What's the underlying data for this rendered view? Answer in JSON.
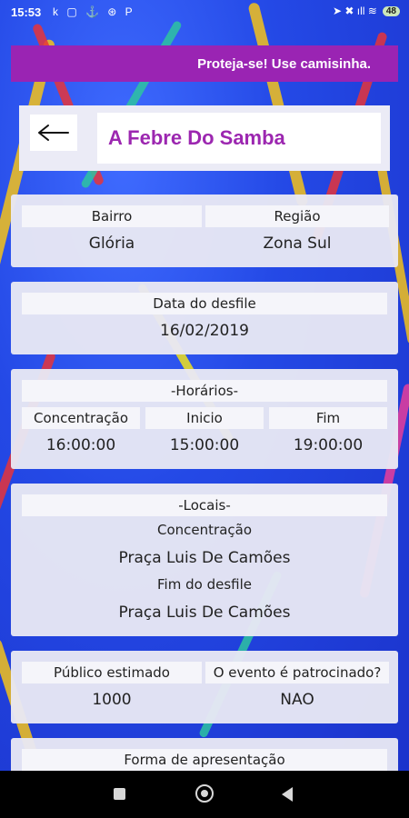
{
  "status_bar": {
    "time": "15:53",
    "left_icons": "k ▢ ⚓ ⊛ P",
    "right_icons": "➤ ✖ ıll ≋",
    "battery": "48"
  },
  "banner": {
    "text": "Proteja-se! Use camisinha."
  },
  "title": {
    "text": "A Febre Do Samba"
  },
  "location": {
    "bairro_label": "Bairro",
    "bairro_value": "Glória",
    "regiao_label": "Região",
    "regiao_value": "Zona Sul"
  },
  "date": {
    "label": "Data do desfile",
    "value": "16/02/2019"
  },
  "horarios": {
    "header": "-Horários-",
    "concentracao_label": "Concentração",
    "concentracao_value": "16:00:00",
    "inicio_label": "Inicio",
    "inicio_value": "15:00:00",
    "fim_label": "Fim",
    "fim_value": "19:00:00"
  },
  "locais": {
    "header": "-Locais-",
    "concentracao_label": "Concentração",
    "concentracao_value": "Praça Luis De Camões",
    "fim_label": "Fim do desfile",
    "fim_value": "Praça Luis De Camões"
  },
  "publico": {
    "label": "Público estimado",
    "value": "1000",
    "patrocinado_label": "O evento é patrocinado?",
    "patrocinado_value": "NAO"
  },
  "forma": {
    "label": "Forma de apresentação"
  },
  "icons": {
    "back": "arrow-left-icon"
  },
  "colors": {
    "banner": "#9a24b3",
    "title": "#9c27b0",
    "background": "#2449e6"
  }
}
